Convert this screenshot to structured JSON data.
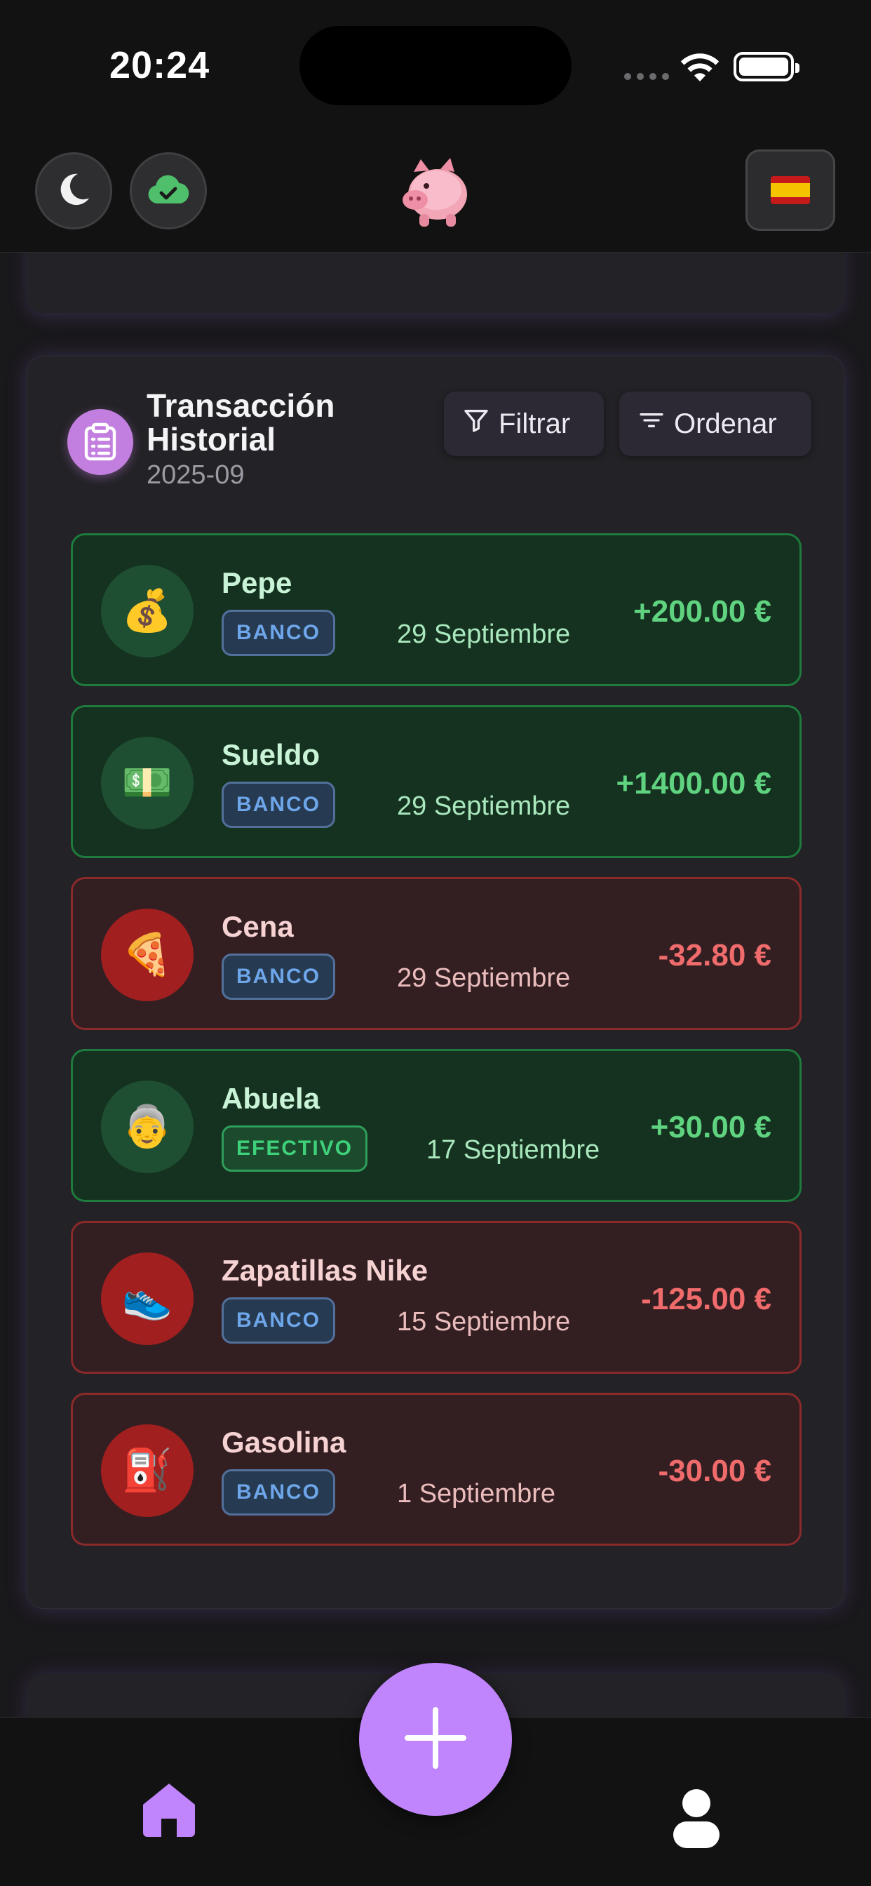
{
  "status_bar": {
    "time": "20:24"
  },
  "header": {
    "theme_icon": "moon-icon",
    "sync_icon": "cloud-check-icon",
    "logo_icon": "piggy-bank-icon",
    "language_icon": "spain-flag-icon"
  },
  "history": {
    "title": "Transacción Historial",
    "subtitle": "2025-09",
    "filter_label": "Filtrar",
    "sort_label": "Ordenar",
    "transactions": [
      {
        "name": "Pepe",
        "badge": "BANCO",
        "date": "29 Septiembre",
        "amount": "+200.00 €",
        "type": "in",
        "emoji": "💰"
      },
      {
        "name": "Sueldo",
        "badge": "BANCO",
        "date": "29 Septiembre",
        "amount": "+1400.00 €",
        "type": "in",
        "emoji": "💵"
      },
      {
        "name": "Cena",
        "badge": "BANCO",
        "date": "29 Septiembre",
        "amount": "-32.80 €",
        "type": "out",
        "emoji": "🍕"
      },
      {
        "name": "Abuela",
        "badge": "EFECTIVO",
        "date": "17 Septiembre",
        "amount": "+30.00 €",
        "type": "in",
        "emoji": "👵"
      },
      {
        "name": "Zapatillas Nike",
        "badge": "BANCO",
        "date": "15 Septiembre",
        "amount": "-125.00 €",
        "type": "out",
        "emoji": "👟"
      },
      {
        "name": "Gasolina",
        "badge": "BANCO",
        "date": "1 Septiembre",
        "amount": "-30.00 €",
        "type": "out",
        "emoji": "⛽"
      }
    ]
  },
  "nav": {
    "home_icon": "home-icon",
    "add_icon": "plus-icon",
    "profile_icon": "user-icon"
  },
  "colors": {
    "accent": "#c084fc",
    "income": "#5fd37f",
    "expense": "#f06b6b"
  }
}
